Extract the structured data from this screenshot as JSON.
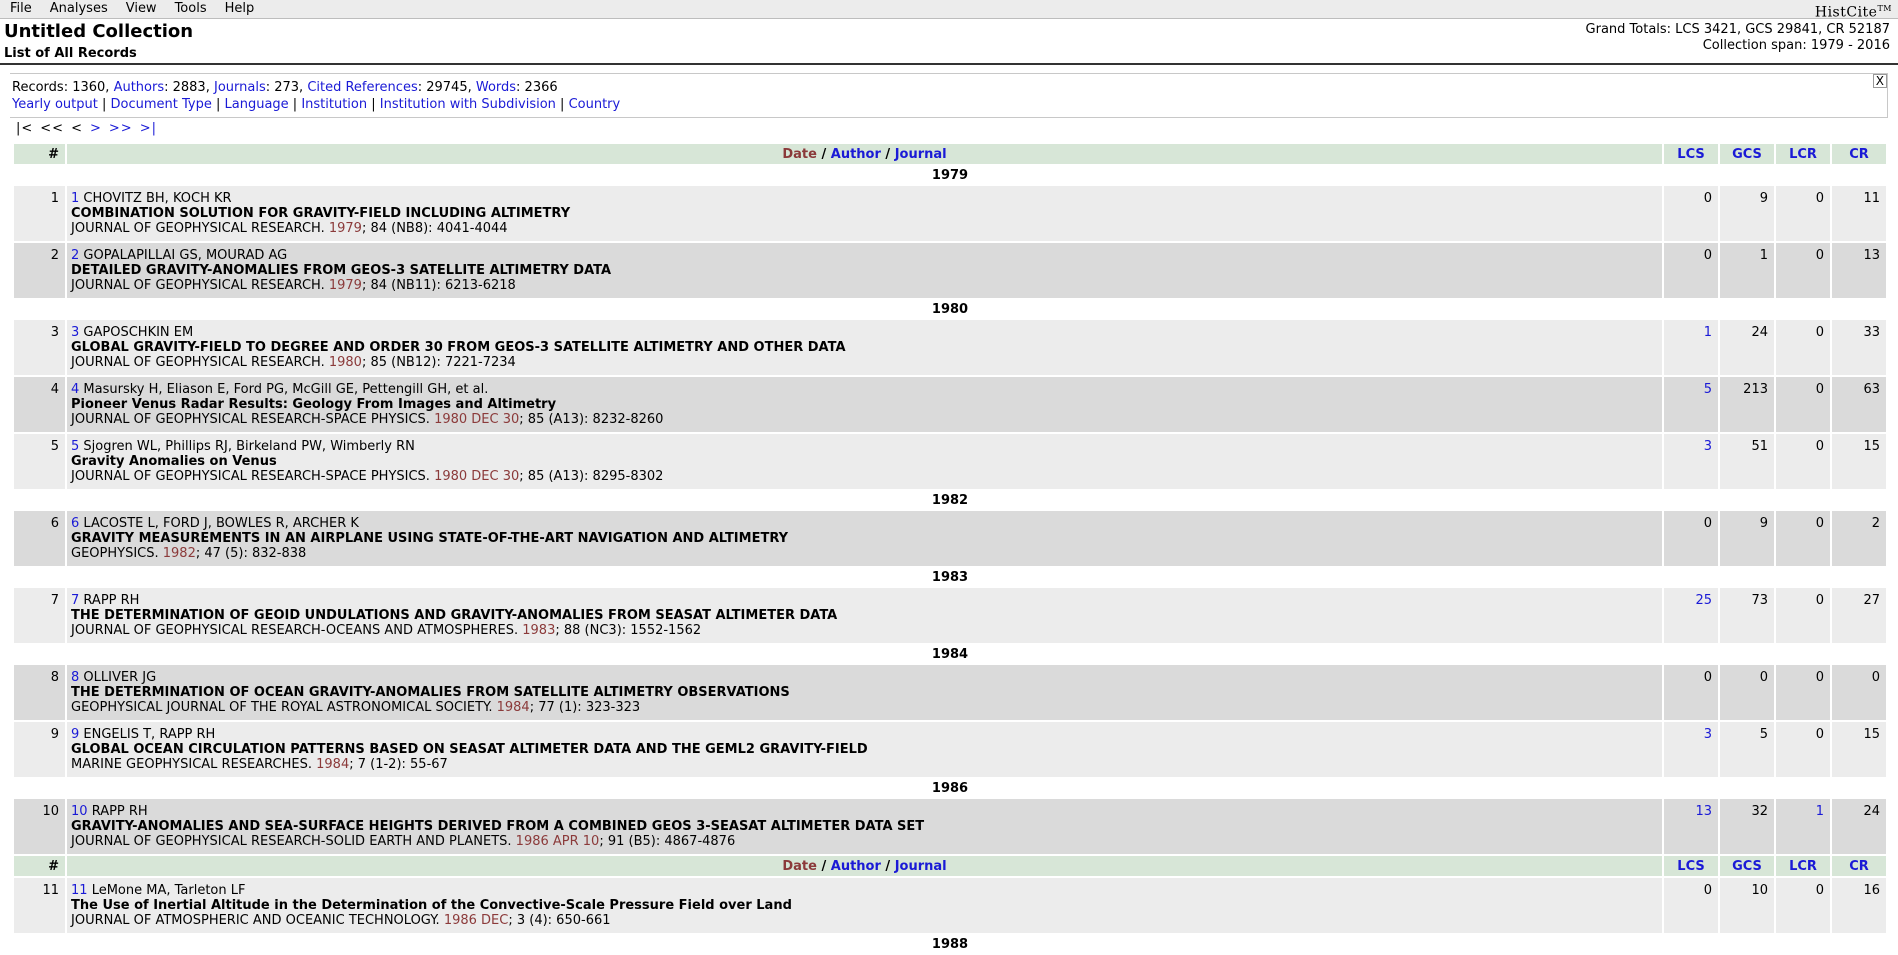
{
  "menu": [
    "File",
    "Analyses",
    "View",
    "Tools",
    "Help"
  ],
  "brand": {
    "name": "HistCite",
    "mark": "TM"
  },
  "collection": {
    "title": "Untitled Collection",
    "subtitle": "List of All Records",
    "grand_totals": "Grand Totals: LCS 3421, GCS 29841, CR 52187",
    "span": "Collection span: 1979 - 2016"
  },
  "stats": {
    "records_label": "Records: ",
    "records_value": "1360",
    "authors_label": "Authors",
    "authors_value": ": 2883, ",
    "journals_label": "Journals",
    "journals_value": ": 273, ",
    "cited_label": "Cited References",
    "cited_value": ": 29745, ",
    "words_label": "Words",
    "words_value": ": 2366",
    "links": [
      "Yearly output",
      "Document Type",
      "Language",
      "Institution",
      "Institution with Subdivision",
      "Country"
    ],
    "close": "X"
  },
  "pager": [
    "|<",
    "<<",
    "<",
    ">",
    ">>",
    ">|"
  ],
  "table": {
    "num_header": "#",
    "date_header": "Date",
    "author_header": "Author",
    "journal_header": "Journal",
    "sep": " / ",
    "lcs": "LCS",
    "gcs": "GCS",
    "lcr": "LCR",
    "cr": "CR"
  },
  "rows": [
    {
      "kind": "year",
      "year": "1979"
    },
    {
      "kind": "rec",
      "num": "1",
      "authors": "CHOVITZ BH, KOCH KR",
      "title": "COMBINATION SOLUTION FOR GRAVITY-FIELD INCLUDING ALTIMETRY",
      "journal": "JOURNAL OF GEOPHYSICAL RESEARCH. ",
      "date": "1979",
      "rest": "; 84 (NB8): 4041-4044",
      "lcs": "0",
      "gcs": "9",
      "lcr": "0",
      "cr": "11"
    },
    {
      "kind": "rec",
      "num": "2",
      "authors": "GOPALAPILLAI GS, MOURAD AG",
      "title": "DETAILED GRAVITY-ANOMALIES FROM GEOS-3 SATELLITE ALTIMETRY DATA",
      "journal": "JOURNAL OF GEOPHYSICAL RESEARCH. ",
      "date": "1979",
      "rest": "; 84 (NB11): 6213-6218",
      "lcs": "0",
      "gcs": "1",
      "lcr": "0",
      "cr": "13"
    },
    {
      "kind": "year",
      "year": "1980"
    },
    {
      "kind": "rec",
      "num": "3",
      "authors": "GAPOSCHKIN EM",
      "title": "GLOBAL GRAVITY-FIELD TO DEGREE AND ORDER 30 FROM GEOS-3 SATELLITE ALTIMETRY AND OTHER DATA",
      "journal": "JOURNAL OF GEOPHYSICAL RESEARCH. ",
      "date": "1980",
      "rest": "; 85 (NB12): 7221-7234",
      "lcs": "1",
      "gcs": "24",
      "lcr": "0",
      "cr": "33"
    },
    {
      "kind": "rec",
      "num": "4",
      "authors": "Masursky H, Eliason E, Ford PG, McGill GE, Pettengill GH, et al.",
      "title": "Pioneer Venus Radar Results: Geology From Images and Altimetry",
      "journal": "JOURNAL OF GEOPHYSICAL RESEARCH-SPACE PHYSICS. ",
      "date": "1980 DEC 30",
      "rest": "; 85 (A13): 8232-8260",
      "lcs": "5",
      "gcs": "213",
      "lcr": "0",
      "cr": "63"
    },
    {
      "kind": "rec",
      "num": "5",
      "authors": "Sjogren WL, Phillips RJ, Birkeland PW, Wimberly RN",
      "title": "Gravity Anomalies on Venus",
      "journal": "JOURNAL OF GEOPHYSICAL RESEARCH-SPACE PHYSICS. ",
      "date": "1980 DEC 30",
      "rest": "; 85 (A13): 8295-8302",
      "lcs": "3",
      "gcs": "51",
      "lcr": "0",
      "cr": "15"
    },
    {
      "kind": "year",
      "year": "1982"
    },
    {
      "kind": "rec",
      "num": "6",
      "authors": "LACOSTE L, FORD J, BOWLES R, ARCHER K",
      "title": "GRAVITY MEASUREMENTS IN AN AIRPLANE USING STATE-OF-THE-ART NAVIGATION AND ALTIMETRY",
      "journal": "GEOPHYSICS. ",
      "date": "1982",
      "rest": "; 47 (5): 832-838",
      "lcs": "0",
      "gcs": "9",
      "lcr": "0",
      "cr": "2"
    },
    {
      "kind": "year",
      "year": "1983"
    },
    {
      "kind": "rec",
      "num": "7",
      "authors": "RAPP RH",
      "title": "THE DETERMINATION OF GEOID UNDULATIONS AND GRAVITY-ANOMALIES FROM SEASAT ALTIMETER DATA",
      "journal": "JOURNAL OF GEOPHYSICAL RESEARCH-OCEANS AND ATMOSPHERES. ",
      "date": "1983",
      "rest": "; 88 (NC3): 1552-1562",
      "lcs": "25",
      "gcs": "73",
      "lcr": "0",
      "cr": "27"
    },
    {
      "kind": "year",
      "year": "1984"
    },
    {
      "kind": "rec",
      "num": "8",
      "authors": "OLLIVER JG",
      "title": "THE DETERMINATION OF OCEAN GRAVITY-ANOMALIES FROM SATELLITE ALTIMETRY OBSERVATIONS",
      "journal": "GEOPHYSICAL JOURNAL OF THE ROYAL ASTRONOMICAL SOCIETY. ",
      "date": "1984",
      "rest": "; 77 (1): 323-323",
      "lcs": "0",
      "gcs": "0",
      "lcr": "0",
      "cr": "0"
    },
    {
      "kind": "rec",
      "num": "9",
      "authors": "ENGELIS T, RAPP RH",
      "title": "GLOBAL OCEAN CIRCULATION PATTERNS BASED ON SEASAT ALTIMETER DATA AND THE GEML2 GRAVITY-FIELD",
      "journal": "MARINE GEOPHYSICAL RESEARCHES. ",
      "date": "1984",
      "rest": "; 7 (1-2): 55-67",
      "lcs": "3",
      "gcs": "5",
      "lcr": "0",
      "cr": "15"
    },
    {
      "kind": "year",
      "year": "1986"
    },
    {
      "kind": "rec",
      "num": "10",
      "authors": "RAPP RH",
      "title": "GRAVITY-ANOMALIES AND SEA-SURFACE HEIGHTS DERIVED FROM A COMBINED GEOS 3-SEASAT ALTIMETER DATA SET",
      "journal": "JOURNAL OF GEOPHYSICAL RESEARCH-SOLID EARTH AND PLANETS. ",
      "date": "1986 APR 10",
      "rest": "; 91 (B5): 4867-4876",
      "lcs": "13",
      "gcs": "32",
      "lcr": "1",
      "cr": "24"
    },
    {
      "kind": "header"
    },
    {
      "kind": "rec",
      "num": "11",
      "authors": "LeMone MA, Tarleton LF",
      "title": "The Use of Inertial Altitude in the Determination of the Convective-Scale Pressure Field over Land",
      "journal": "JOURNAL OF ATMOSPHERIC AND OCEANIC TECHNOLOGY. ",
      "date": "1986 DEC",
      "rest": "; 3 (4): 650-661",
      "lcs": "0",
      "gcs": "10",
      "lcr": "0",
      "cr": "16"
    },
    {
      "kind": "year",
      "year": "1988"
    }
  ]
}
